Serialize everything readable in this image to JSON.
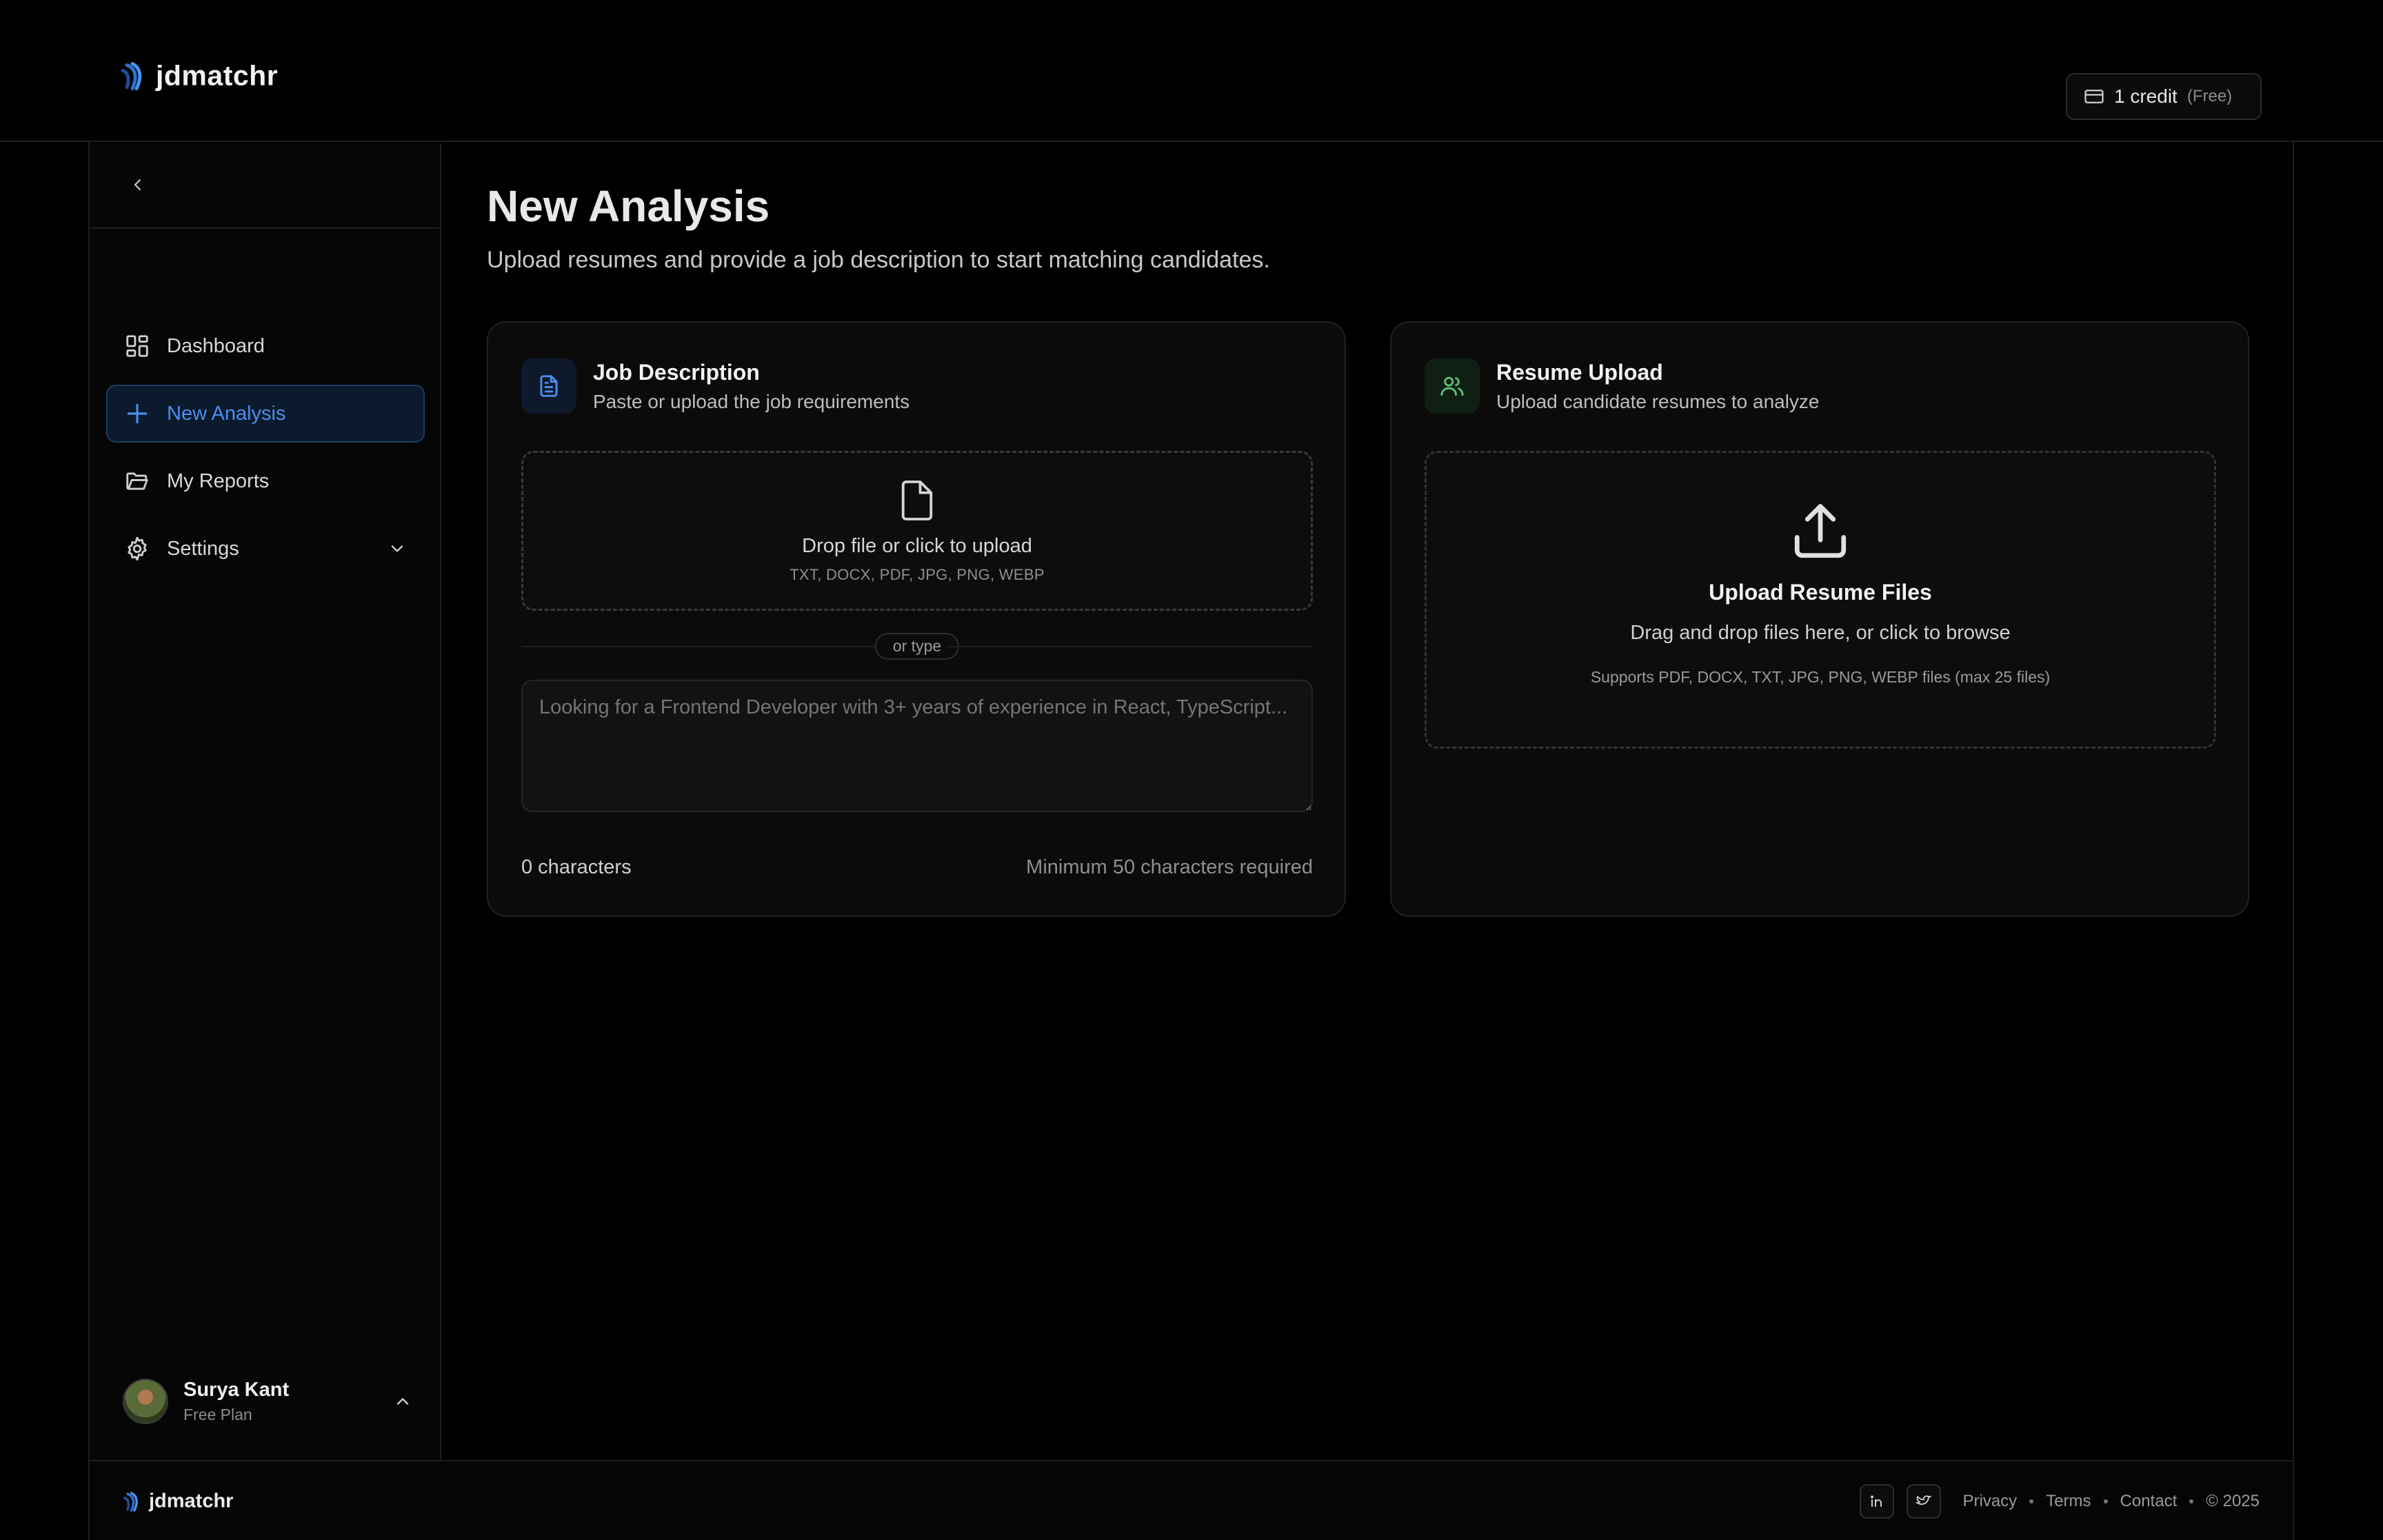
{
  "app": {
    "brand": "jdmatchr",
    "accent_color": "#4a90f0"
  },
  "header": {
    "credit_label": "1 credit",
    "credit_plan": "(Free)",
    "credit_icon": "credit-card-icon"
  },
  "sidebar": {
    "collapse_icon": "chevron-left-icon",
    "items": [
      {
        "label": "Dashboard",
        "icon": "dashboard-icon",
        "active": false
      },
      {
        "label": "New Analysis",
        "icon": "plus-icon",
        "active": true
      },
      {
        "label": "My Reports",
        "icon": "folder-icon",
        "active": false
      },
      {
        "label": "Settings",
        "icon": "gear-icon",
        "active": false,
        "expandable": true
      }
    ],
    "user": {
      "name": "Surya Kant",
      "plan": "Free Plan"
    }
  },
  "main": {
    "title": "New Analysis",
    "subtitle": "Upload resumes and provide a job description to start matching candidates.",
    "job_description": {
      "title": "Job Description",
      "subtitle": "Paste or upload the job requirements",
      "drop_title": "Drop file or click to upload",
      "drop_formats": "TXT, DOCX, PDF, JPG, PNG, WEBP",
      "divider_label": "or type",
      "textarea_placeholder": "Looking for a Frontend Developer with 3+ years of experience in React, TypeScript...",
      "textarea_value": "",
      "char_count": "0 characters",
      "min_requirement": "Minimum 50 characters required"
    },
    "resume_upload": {
      "title": "Resume Upload",
      "subtitle": "Upload candidate resumes to analyze",
      "drop_title": "Upload Resume Files",
      "drop_subtitle": "Drag and drop files here, or click to browse",
      "drop_note": "Supports PDF, DOCX, TXT, JPG, PNG, WEBP files (max 25 files)"
    }
  },
  "footer": {
    "brand": "jdmatchr",
    "social": [
      "linkedin-icon",
      "twitter-icon"
    ],
    "links": [
      "Privacy",
      "Terms",
      "Contact"
    ],
    "copyright": "© 2025"
  }
}
